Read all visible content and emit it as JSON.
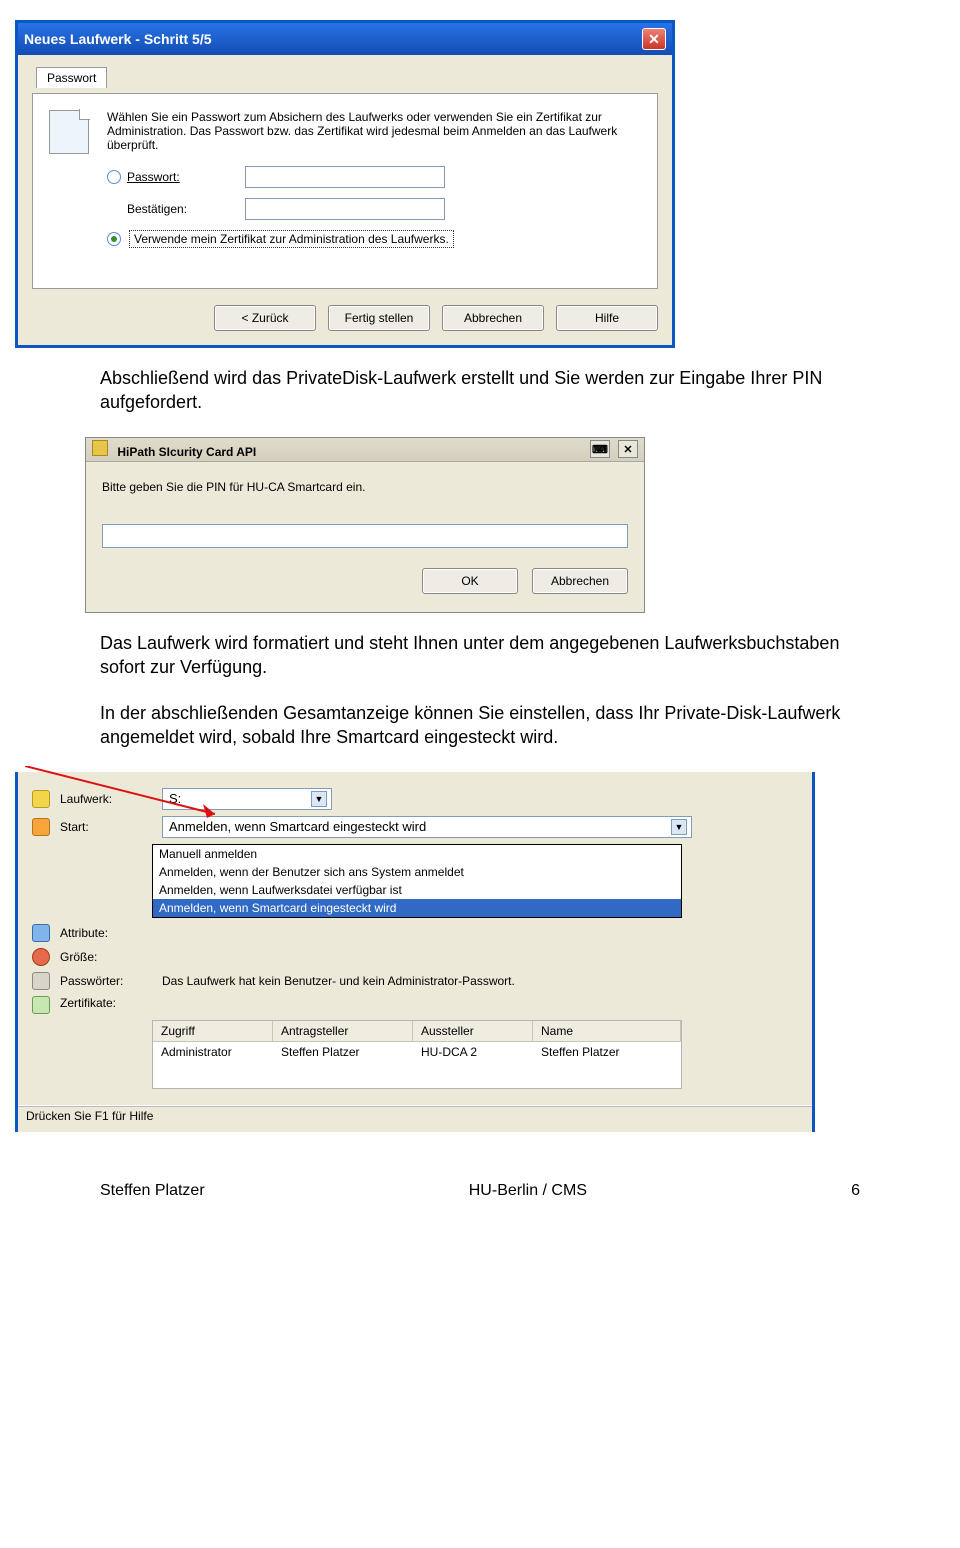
{
  "dialog1": {
    "title": "Neues Laufwerk - Schritt 5/5",
    "tab": "Passwort",
    "description": "Wählen Sie ein Passwort zum Absichern des Laufwerks oder verwenden Sie ein Zertifikat zur Administration. Das Passwort bzw. das Zertifikat wird jedesmal beim Anmelden an das Laufwerk überprüft.",
    "radio_password_label": "Passwort:",
    "confirm_label": "Bestätigen:",
    "radio_cert_label": "Verwende mein Zertifikat zur Administration des Laufwerks.",
    "buttons": {
      "back": "< Zurück",
      "finish": "Fertig stellen",
      "cancel": "Abbrechen",
      "help": "Hilfe"
    }
  },
  "para1": "Abschließend wird das PrivateDisk-Laufwerk erstellt und Sie werden zur Eingabe Ihrer PIN aufgefordert.",
  "dialog2": {
    "title": "HiPath SIcurity Card API",
    "prompt": "Bitte geben Sie die PIN für HU-CA Smartcard ein.",
    "ok": "OK",
    "cancel": "Abbrechen"
  },
  "para2": "Das Laufwerk wird formatiert und steht Ihnen unter dem angegebenen Laufwerksbuchstaben sofort zur Verfügung.",
  "para3": "In der abschließenden Gesamtanzeige können Sie einstellen, dass Ihr Private-Disk-Laufwerk angemeldet wird, sobald Ihre Smartcard eingesteckt wird.",
  "settings": {
    "drive_label": "Laufwerk:",
    "drive_value": "S:",
    "start_label": "Start:",
    "start_value": "Anmelden, wenn Smartcard eingesteckt wird",
    "start_options": [
      "Manuell anmelden",
      "Anmelden, wenn der Benutzer sich ans System anmeldet",
      "Anmelden, wenn Laufwerksdatei verfügbar ist",
      "Anmelden, wenn Smartcard eingesteckt wird"
    ],
    "attribute_label": "Attribute:",
    "size_label": "Größe:",
    "passwords_label": "Passwörter:",
    "passwords_value": "Das Laufwerk hat kein Benutzer- und kein Administrator-Passwort.",
    "cert_label": "Zertifikate:",
    "cert_headers": {
      "access": "Zugriff",
      "applicant": "Antragsteller",
      "issuer": "Aussteller",
      "name": "Name"
    },
    "cert_row": {
      "access": "Administrator",
      "applicant": "Steffen Platzer",
      "issuer": "HU-DCA 2",
      "name": "Steffen Platzer"
    },
    "statusbar": "Drücken Sie F1 für Hilfe"
  },
  "footer": {
    "author": "Steffen Platzer",
    "org": "HU-Berlin / CMS",
    "page": "6"
  }
}
